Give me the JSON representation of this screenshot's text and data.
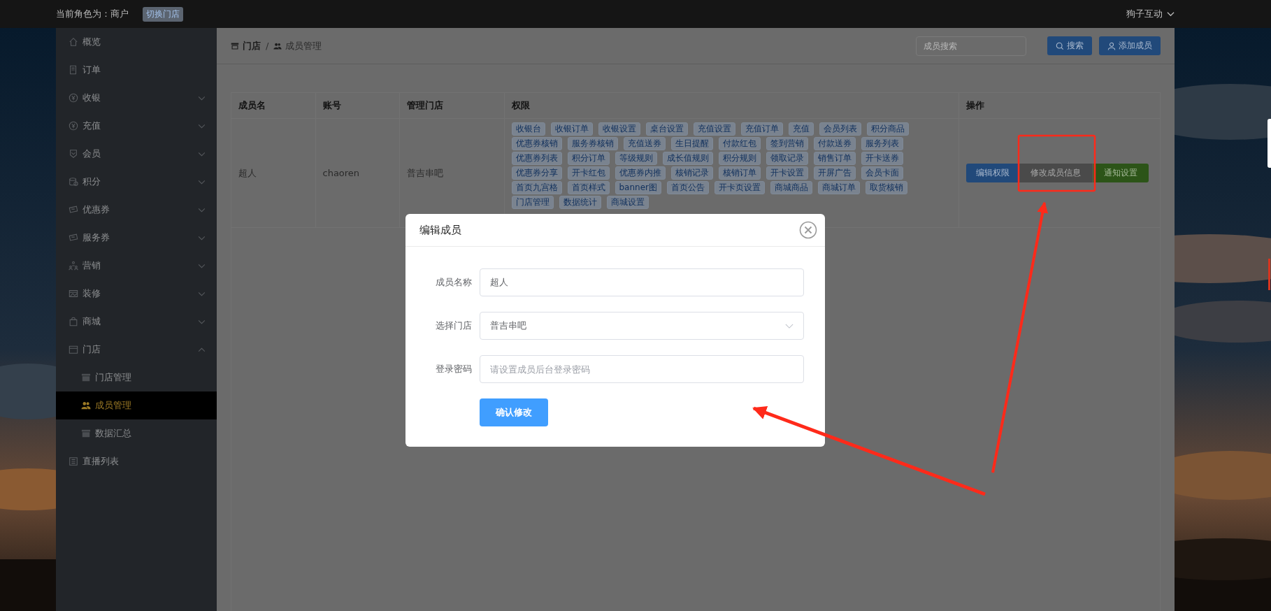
{
  "top_bar": {
    "role_label": "当前角色为：商户",
    "switch_button": "切换门店",
    "user_name": "狗子互动"
  },
  "sidebar": {
    "items": [
      {
        "label": "概览",
        "selected": false
      },
      {
        "label": "订单",
        "selected": false
      },
      {
        "label": "收银",
        "selected": false,
        "expanded": false
      },
      {
        "label": "充值",
        "selected": false,
        "expanded": false
      },
      {
        "label": "会员",
        "selected": false,
        "expanded": false
      },
      {
        "label": "积分",
        "selected": false,
        "expanded": false
      },
      {
        "label": "优惠券",
        "selected": false,
        "expanded": false
      },
      {
        "label": "服务券",
        "selected": false,
        "expanded": false
      },
      {
        "label": "营销",
        "selected": false,
        "expanded": false
      },
      {
        "label": "装修",
        "selected": false,
        "expanded": false
      },
      {
        "label": "商城",
        "selected": false,
        "expanded": false
      },
      {
        "label": "门店",
        "selected": false,
        "expanded": true,
        "children": [
          {
            "label": "门店管理",
            "selected": false
          },
          {
            "label": "成员管理",
            "selected": true
          },
          {
            "label": "数据汇总",
            "selected": false
          }
        ]
      },
      {
        "label": "直播列表",
        "selected": false
      }
    ]
  },
  "breadcrumb": [
    "门店",
    "成员管理"
  ],
  "breadcrumb_separator": "/",
  "search": {
    "placeholder": "成员搜索"
  },
  "header_buttons": [
    "搜索",
    "添加成员"
  ],
  "table": {
    "columns": [
      "成员名",
      "账号",
      "管理门店",
      "权限",
      "操作"
    ],
    "rows": [
      {
        "cells": [
          "超人",
          "chaoren",
          "普吉串吧"
        ],
        "permissions": [
          "收银台",
          "收银订单",
          "收银设置",
          "桌台设置",
          "充值设置",
          "充值订单",
          "充值",
          "会员列表",
          "积分商品",
          "优惠券核销",
          "服务券核销",
          "充值送券",
          "生日提醒",
          "付款红包",
          "签到营销",
          "付款送券",
          "服务列表",
          "优惠券列表",
          "积分订单",
          "等级规则",
          "成长值规则",
          "积分规则",
          "领取记录",
          "销售订单",
          "开卡送券",
          "优惠券分享",
          "开卡红包",
          "优惠券内推",
          "核销记录",
          "核销订单",
          "开卡设置",
          "开屏广告",
          "会员卡面",
          "首页九宫格",
          "首页样式",
          "banner图",
          "首页公告",
          "开卡页设置",
          "商城商品",
          "商城订单",
          "取货核销",
          "门店管理",
          "数据统计",
          "商城设置"
        ],
        "actions": [
          {
            "label": "编辑权限",
            "kind": "primary"
          },
          {
            "label": "修改成员信息",
            "kind": "muted"
          },
          {
            "label": "通知设置",
            "kind": "success"
          }
        ]
      }
    ]
  },
  "modal": {
    "title": "编辑成员",
    "fields": [
      {
        "label": "成员名称",
        "kind": "text",
        "value": "超人"
      },
      {
        "label": "选择门店",
        "kind": "select",
        "value": "普吉串吧"
      },
      {
        "label": "登录密码",
        "kind": "password",
        "placeholder": "请设置成员后台登录密码"
      }
    ],
    "submit": "确认修改"
  }
}
